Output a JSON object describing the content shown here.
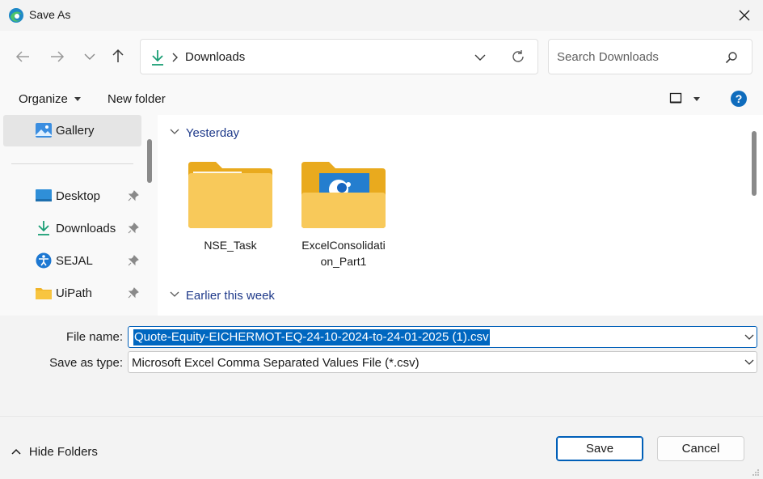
{
  "window": {
    "title": "Save As"
  },
  "nav": {
    "address_segment": "Downloads",
    "search_placeholder": "Search Downloads"
  },
  "commands": {
    "organize": "Organize",
    "new_folder": "New folder"
  },
  "sidebar": {
    "items": [
      {
        "label": "Gallery",
        "icon": "gallery-icon",
        "selected": true
      },
      {
        "label": "Desktop",
        "icon": "desktop-icon",
        "pinned": true
      },
      {
        "label": "Downloads",
        "icon": "download-icon",
        "pinned": true
      },
      {
        "label": "SEJAL",
        "icon": "accessibility-icon",
        "pinned": true
      },
      {
        "label": "UiPath",
        "icon": "folder-icon",
        "pinned": true
      }
    ]
  },
  "content": {
    "groups": [
      {
        "header": "Yesterday",
        "items": [
          {
            "name": "NSE_Task",
            "type": "folder"
          },
          {
            "name_line1": "ExcelConsolidati",
            "name_line2": "on_Part1",
            "type": "folder-with-image"
          }
        ]
      },
      {
        "header": "Earlier this week"
      }
    ]
  },
  "form": {
    "file_name_label": "File name:",
    "file_name_value": "Quote-Equity-EICHERMOT-EQ-24-10-2024-to-24-01-2025 (1).csv",
    "save_type_label": "Save as type:",
    "save_type_value": "Microsoft Excel Comma Separated Values File (*.csv)"
  },
  "footer": {
    "hide_folders": "Hide Folders",
    "save": "Save",
    "cancel": "Cancel"
  },
  "colors": {
    "accent": "#005fb8",
    "selection": "#0067c0",
    "folder": "#f8c540",
    "header_text": "#1f3a8a"
  }
}
